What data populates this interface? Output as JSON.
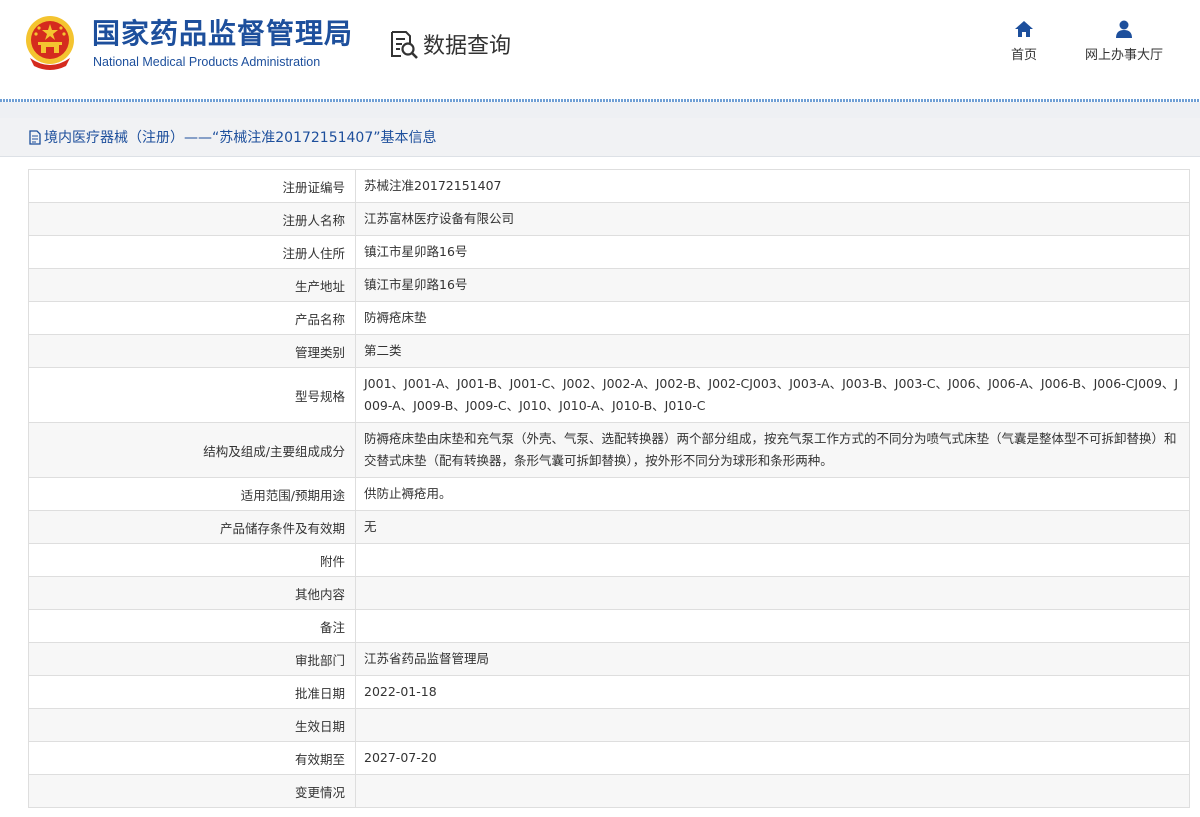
{
  "header": {
    "org_name_cn": "国家药品监督管理局",
    "org_name_en": "National Medical Products Administration",
    "query_title": "数据查询",
    "nav": [
      {
        "label": "首页",
        "icon": "home-icon"
      },
      {
        "label": "网上办事大厅",
        "icon": "user-icon"
      }
    ]
  },
  "page": {
    "title": "境内医疗器械（注册）——“苏械注准20172151407”基本信息"
  },
  "rows": [
    {
      "label": "注册证编号",
      "value": "苏械注准20172151407"
    },
    {
      "label": "注册人名称",
      "value": "江苏富林医疗设备有限公司"
    },
    {
      "label": "注册人住所",
      "value": "镇江市星卯路16号"
    },
    {
      "label": "生产地址",
      "value": "镇江市星卯路16号"
    },
    {
      "label": "产品名称",
      "value": "防褥疮床垫"
    },
    {
      "label": "管理类别",
      "value": "第二类"
    },
    {
      "label": "型号规格",
      "value": "J001、J001-A、J001-B、J001-C、J002、J002-A、J002-B、J002-CJ003、J003-A、J003-B、J003-C、J006、J006-A、J006-B、J006-CJ009、J009-A、J009-B、J009-C、J010、J010-A、J010-B、J010-C"
    },
    {
      "label": "结构及组成/主要组成成分",
      "value": "防褥疮床垫由床垫和充气泵（外壳、气泵、选配转换器）两个部分组成，按充气泵工作方式的不同分为喷气式床垫（气囊是整体型不可拆卸替换）和交替式床垫（配有转换器，条形气囊可拆卸替换），按外形不同分为球形和条形两种。"
    },
    {
      "label": "适用范围/预期用途",
      "value": "供防止褥疮用。"
    },
    {
      "label": "产品储存条件及有效期",
      "value": "无"
    },
    {
      "label": "附件",
      "value": ""
    },
    {
      "label": "其他内容",
      "value": ""
    },
    {
      "label": "备注",
      "value": ""
    },
    {
      "label": "审批部门",
      "value": "江苏省药品监督管理局"
    },
    {
      "label": "批准日期",
      "value": "2022-01-18"
    },
    {
      "label": "生效日期",
      "value": ""
    },
    {
      "label": "有效期至",
      "value": "2027-07-20"
    },
    {
      "label": "变更情况",
      "value": ""
    }
  ],
  "colors": {
    "brand_blue": "#1d4f9c",
    "emblem_red": "#d52b1e",
    "emblem_gold": "#f4c430"
  }
}
